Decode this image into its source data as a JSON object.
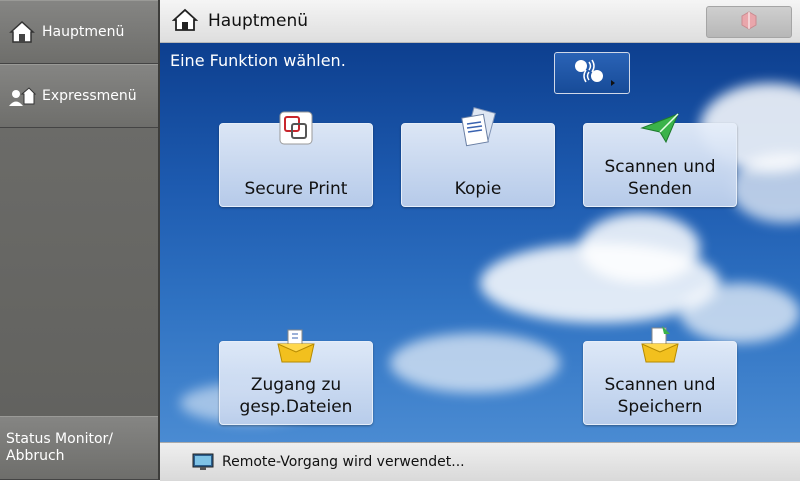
{
  "sidebar": {
    "home_label": "Hauptmenü",
    "express_label": "Expressmenü",
    "status_label_line1": "Status Monitor/",
    "status_label_line2": "Abbruch"
  },
  "header": {
    "title": "Hauptmenü"
  },
  "main": {
    "instruction": "Eine Funktion wählen.",
    "tiles": [
      {
        "line1": "Secure Print",
        "line2": ""
      },
      {
        "line1": "Kopie",
        "line2": ""
      },
      {
        "line1": "Scannen und",
        "line2": "Senden"
      },
      {
        "line1": "Zugang zu",
        "line2": "gesp.Dateien"
      },
      {
        "line1": "Scannen und",
        "line2": "Speichern"
      }
    ]
  },
  "status": {
    "message": "Remote-Vorgang wird verwendet..."
  },
  "colors": {
    "sky": "#1d5aaf",
    "sidebar": "#6f6f6c",
    "accent_green": "#3bb34a",
    "folder_yellow": "#f2c01e"
  }
}
